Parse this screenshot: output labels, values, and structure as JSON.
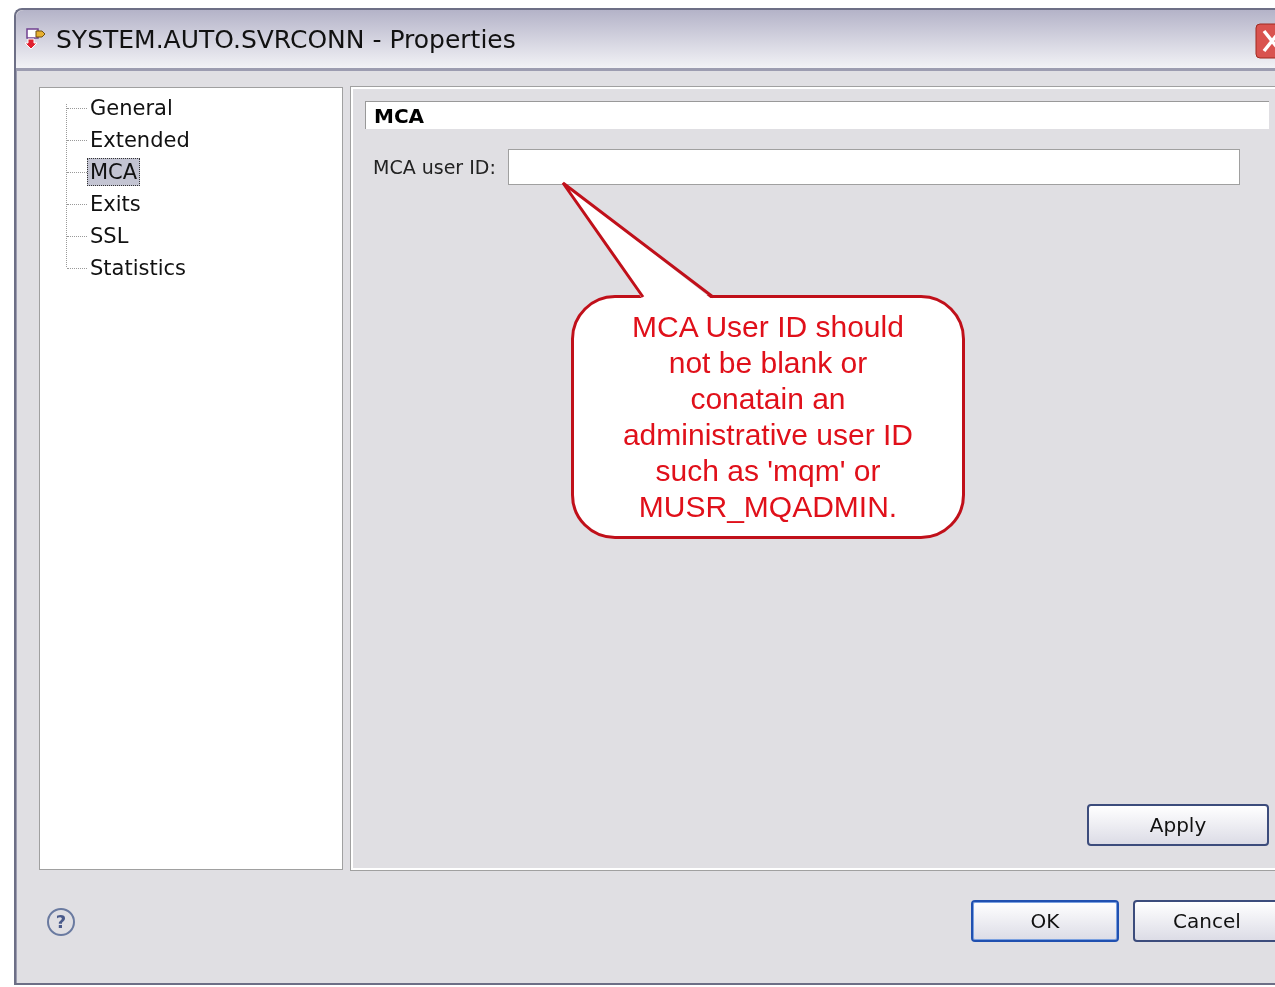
{
  "window": {
    "title": "SYSTEM.AUTO.SVRCONN - Properties"
  },
  "tree": {
    "items": [
      {
        "label": "General",
        "selected": false
      },
      {
        "label": "Extended",
        "selected": false
      },
      {
        "label": "MCA",
        "selected": true
      },
      {
        "label": "Exits",
        "selected": false
      },
      {
        "label": "SSL",
        "selected": false
      },
      {
        "label": "Statistics",
        "selected": false
      }
    ]
  },
  "page": {
    "heading": "MCA",
    "field_label": "MCA user ID:",
    "apply": "Apply"
  },
  "callout": "MCA User ID should\nnot be blank or\nconatain an\nadministrative user ID\nsuch as 'mqm' or\nMUSR_MQADMIN.",
  "help": "?",
  "buttons": [
    "OK",
    "Cancel"
  ]
}
